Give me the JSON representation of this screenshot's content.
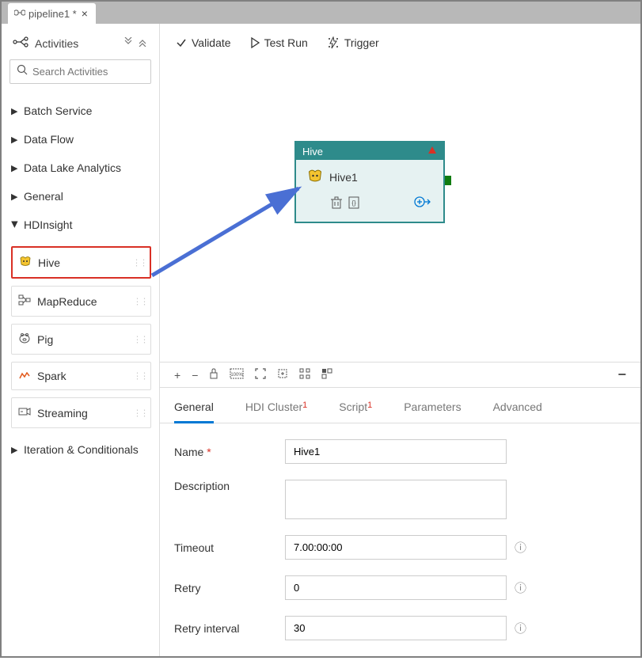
{
  "tab": {
    "title": "pipeline1 *"
  },
  "sidebar": {
    "activitiesLabel": "Activities",
    "searchPlaceholder": "Search Activities",
    "categories": [
      {
        "label": "Batch Service",
        "expanded": false
      },
      {
        "label": "Data Flow",
        "expanded": false
      },
      {
        "label": "Data Lake Analytics",
        "expanded": false
      },
      {
        "label": "General",
        "expanded": false
      },
      {
        "label": "HDInsight",
        "expanded": true
      },
      {
        "label": "Iteration & Conditionals",
        "expanded": false
      }
    ],
    "hdinsight_items": [
      {
        "label": "Hive",
        "highlighted": true
      },
      {
        "label": "MapReduce",
        "highlighted": false
      },
      {
        "label": "Pig",
        "highlighted": false
      },
      {
        "label": "Spark",
        "highlighted": false
      },
      {
        "label": "Streaming",
        "highlighted": false
      }
    ]
  },
  "toolbar": {
    "validate": "Validate",
    "testrun": "Test Run",
    "trigger": "Trigger"
  },
  "node": {
    "type": "Hive",
    "title": "Hive1"
  },
  "properties": {
    "tabs": [
      {
        "label": "General",
        "active": true,
        "errorCount": 0
      },
      {
        "label": "HDI Cluster",
        "active": false,
        "errorCount": 1
      },
      {
        "label": "Script",
        "active": false,
        "errorCount": 1
      },
      {
        "label": "Parameters",
        "active": false,
        "errorCount": 0
      },
      {
        "label": "Advanced",
        "active": false,
        "errorCount": 0
      }
    ],
    "fields": {
      "nameLabel": "Name",
      "nameValue": "Hive1",
      "descriptionLabel": "Description",
      "descriptionValue": "",
      "timeoutLabel": "Timeout",
      "timeoutValue": "7.00:00:00",
      "retryLabel": "Retry",
      "retryValue": "0",
      "retryIntervalLabel": "Retry interval",
      "retryIntervalValue": "30"
    }
  }
}
